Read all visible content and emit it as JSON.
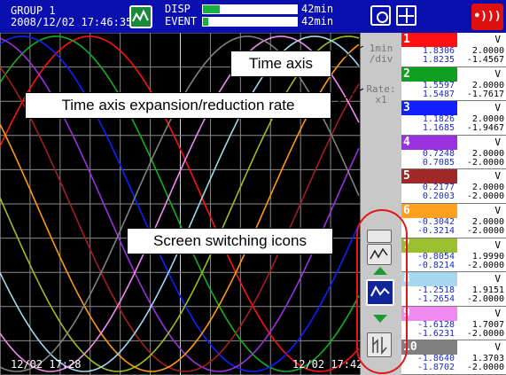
{
  "status_bar": {
    "group_name": "GROUP 1",
    "datetime": "2008/12/02 17:46:35",
    "disp_label": "DISP",
    "event_label": "EVENT",
    "disp_time": "42min",
    "event_time": "42min",
    "disp_fill_pct": 18,
    "event_fill_pct": 6,
    "alarm_glyph": "•)))",
    "icons": [
      "display-mode-icon",
      "snapshot-icon",
      "calc-icon",
      "alarm-icon"
    ]
  },
  "info_column": {
    "timeaxis_value": "1min",
    "timeaxis_unit": "/div",
    "rate_label": "Rate:",
    "rate_value": "x1"
  },
  "trend": {
    "time_left": "12/02 17:28",
    "time_right": "12/02 17:42",
    "colors": [
      "#ff1010",
      "#10b020",
      "#1020ff",
      "#9a30e0",
      "#a02020",
      "#ff9a10",
      "#9ac020",
      "#a0d8f0",
      "#f08af0",
      "#808080"
    ]
  },
  "channels": [
    {
      "num": "1",
      "unit": "V",
      "v1": "1.8306",
      "v2": "1.8235",
      "s1": "2.0000",
      "s2": "-1.4567",
      "color": "#ff1010"
    },
    {
      "num": "2",
      "unit": "V",
      "v1": "1.5597",
      "v2": "1.5487",
      "s1": "2.0000",
      "s2": "-1.7617",
      "color": "#10a020"
    },
    {
      "num": "3",
      "unit": "V",
      "v1": "1.1826",
      "v2": "1.1685",
      "s1": "2.0000",
      "s2": "-1.9467",
      "color": "#1020ff"
    },
    {
      "num": "4",
      "unit": "V",
      "v1": "0.7248",
      "v2": "0.7085",
      "s1": "2.0000",
      "s2": "-2.0000",
      "color": "#9a30e0"
    },
    {
      "num": "5",
      "unit": "V",
      "v1": "0.2177",
      "v2": "0.2003",
      "s1": "2.0000",
      "s2": "-2.0000",
      "color": "#a02828"
    },
    {
      "num": "6",
      "unit": "V",
      "v1": "-0.3042",
      "v2": "-0.3214",
      "s1": "2.0000",
      "s2": "-2.0000",
      "color": "#ffa020"
    },
    {
      "num": "7",
      "unit": "V",
      "v1": "-0.8054",
      "v2": "-0.8214",
      "s1": "1.9990",
      "s2": "-2.0000",
      "color": "#9ac030"
    },
    {
      "num": "8",
      "unit": "V",
      "v1": "-1.2518",
      "v2": "-1.2654",
      "s1": "1.9151",
      "s2": "-2.0000",
      "color": "#a8d8f0"
    },
    {
      "num": "9",
      "unit": "V",
      "v1": "-1.6128",
      "v2": "-1.6231",
      "s1": "1.7007",
      "s2": "-2.0000",
      "color": "#f08af0"
    },
    {
      "num": "10",
      "unit": "V",
      "v1": "-1.8640",
      "v2": "-1.8702",
      "s1": "1.3703",
      "s2": "-2.0000",
      "color": "#808080"
    }
  ],
  "callouts": {
    "time_axis": "Time axis",
    "rate": "Time axis expansion/reduction rate",
    "screen_switching": "Screen switching icons"
  }
}
